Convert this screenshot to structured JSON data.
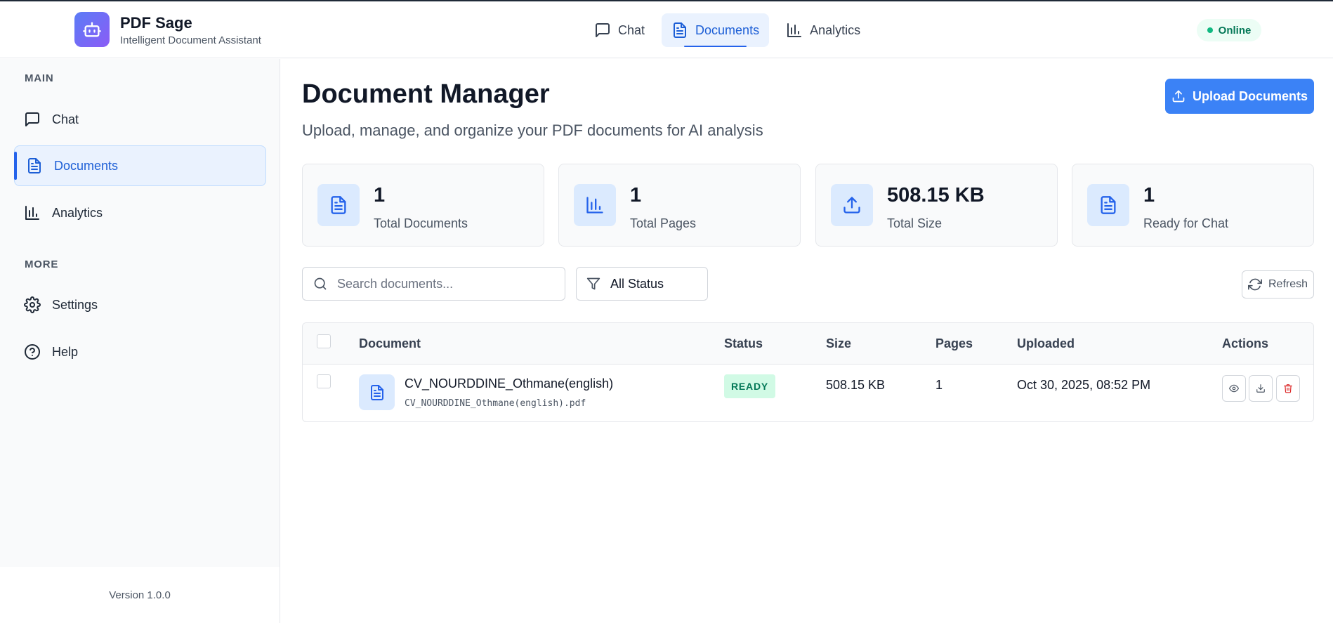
{
  "app": {
    "name": "PDF Sage",
    "tagline": "Intelligent Document Assistant",
    "status": "Online",
    "logo_icon": "robot-icon",
    "colors": {
      "accent": "#3b82f6",
      "status_ok": "#10b981",
      "danger": "#dc2626"
    }
  },
  "topnav": {
    "items": [
      {
        "label": "Chat",
        "icon": "message-square-icon",
        "active": false
      },
      {
        "label": "Documents",
        "icon": "file-text-icon",
        "active": true
      },
      {
        "label": "Analytics",
        "icon": "bar-chart-icon",
        "active": false
      }
    ]
  },
  "sidebar": {
    "main_label": "MAIN",
    "more_label": "MORE",
    "items": [
      {
        "label": "Chat",
        "icon": "message-square-icon"
      },
      {
        "label": "Documents",
        "icon": "file-text-icon",
        "active": true
      },
      {
        "label": "Analytics",
        "icon": "bar-chart-icon"
      },
      {
        "label": "Settings",
        "icon": "gear-icon"
      },
      {
        "label": "Help",
        "icon": "help-circle-icon"
      }
    ],
    "version": "Version 1.0.0"
  },
  "main": {
    "title": "Document Manager",
    "subtitle": "Upload, manage, and organize your PDF documents for AI analysis",
    "upload_label": "Upload Documents",
    "stats": [
      {
        "value": "1",
        "label": "Total Documents",
        "icon": "file-text-icon"
      },
      {
        "value": "1",
        "label": "Total Pages",
        "icon": "bar-chart-icon"
      },
      {
        "value": "508.15 KB",
        "label": "Total Size",
        "icon": "upload-icon"
      },
      {
        "value": "1",
        "label": "Ready for Chat",
        "icon": "file-text-icon"
      }
    ],
    "search": {
      "placeholder": "Search documents...",
      "value": ""
    },
    "filter": {
      "selected": "All Status"
    },
    "refresh_label": "Refresh"
  },
  "table": {
    "headers": [
      "Document",
      "Status",
      "Size",
      "Pages",
      "Uploaded",
      "Actions"
    ],
    "rows": [
      {
        "name": "CV_NOURDDINE_Othmane(english)",
        "filename": "CV_NOURDDINE_Othmane(english).pdf",
        "status": "READY",
        "size": "508.15 KB",
        "pages": "1",
        "uploaded": "Oct 30, 2025, 08:52 PM",
        "actions": [
          "eye-icon",
          "download-icon",
          "trash-icon"
        ]
      }
    ]
  }
}
